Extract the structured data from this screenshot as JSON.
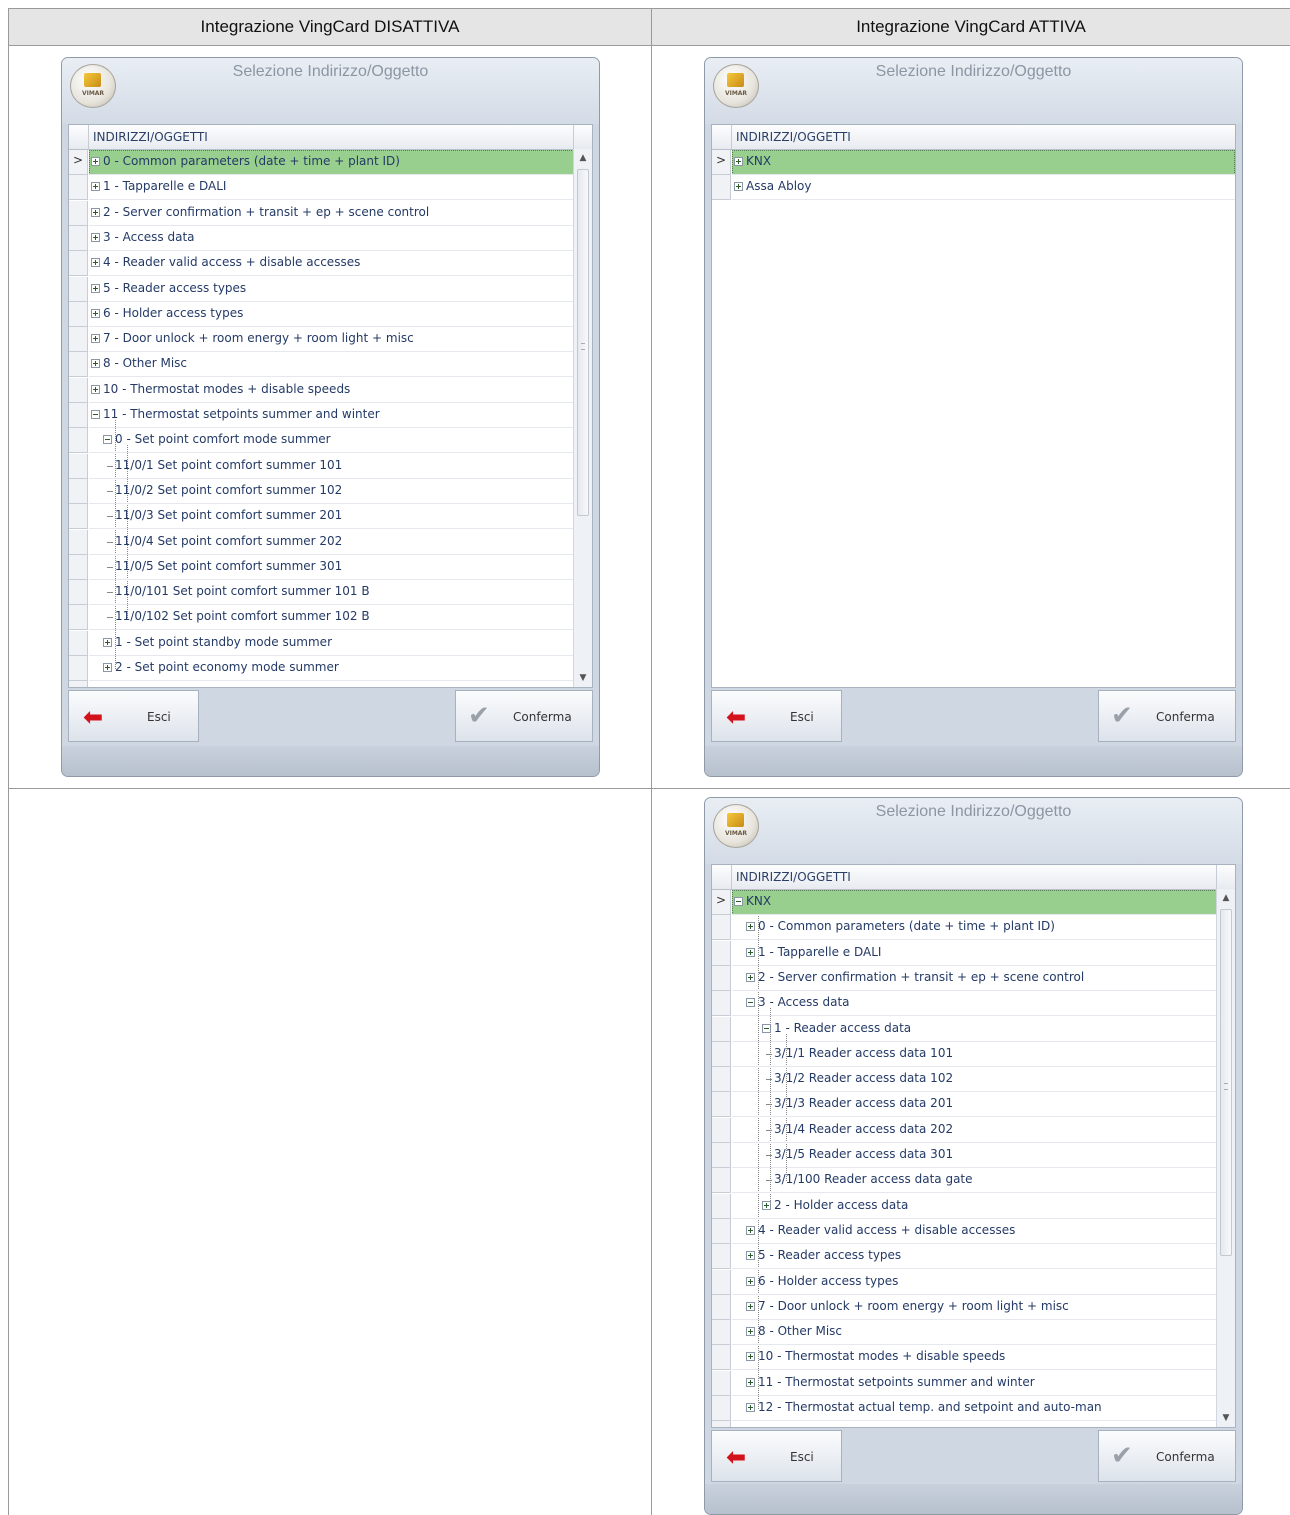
{
  "columns": {
    "left_header": "Integrazione VingCard DISATTIVA",
    "right_header": "Integrazione VingCard ATTIVA"
  },
  "windows": [
    {
      "title": "Selezione Indirizzo/Oggetto",
      "logo_text": "VIMAR",
      "grid_header": "INDIRIZZI/OGGETTI",
      "exit_label": "Esci",
      "confirm_label": "Conferma",
      "show_scrollbar": true,
      "rows": [
        {
          "label": "0 - Common parameters (date + time + plant ID)",
          "level": 0,
          "expander": "plus",
          "selected": true
        },
        {
          "label": "1 - Tapparelle e DALI",
          "level": 0,
          "expander": "plus"
        },
        {
          "label": "2 - Server confirmation + transit + ep + scene control",
          "level": 0,
          "expander": "plus"
        },
        {
          "label": "3 - Access data",
          "level": 0,
          "expander": "plus"
        },
        {
          "label": "4 - Reader valid access + disable accesses",
          "level": 0,
          "expander": "plus"
        },
        {
          "label": "5 - Reader access types",
          "level": 0,
          "expander": "plus"
        },
        {
          "label": "6 - Holder access types",
          "level": 0,
          "expander": "plus"
        },
        {
          "label": "7 - Door unlock + room energy + room light + misc",
          "level": 0,
          "expander": "plus"
        },
        {
          "label": "8 - Other Misc",
          "level": 0,
          "expander": "plus"
        },
        {
          "label": "10 - Thermostat modes + disable speeds",
          "level": 0,
          "expander": "plus"
        },
        {
          "label": "11 - Thermostat setpoints summer and winter",
          "level": 0,
          "expander": "minus"
        },
        {
          "label": "0 - Set point comfort mode summer",
          "level": 1,
          "expander": "minus"
        },
        {
          "label": "11/0/1 Set point comfort summer 101",
          "level": 2,
          "expander": "none"
        },
        {
          "label": "11/0/2 Set point comfort summer 102",
          "level": 2,
          "expander": "none"
        },
        {
          "label": "11/0/3 Set point comfort summer 201",
          "level": 2,
          "expander": "none"
        },
        {
          "label": "11/0/4 Set point comfort summer 202",
          "level": 2,
          "expander": "none"
        },
        {
          "label": "11/0/5 Set point comfort summer 301",
          "level": 2,
          "expander": "none"
        },
        {
          "label": "11/0/101 Set point comfort summer 101 B",
          "level": 2,
          "expander": "none"
        },
        {
          "label": "11/0/102 Set point comfort summer 102 B",
          "level": 2,
          "expander": "none"
        },
        {
          "label": "1 - Set point standby mode summer",
          "level": 1,
          "expander": "plus"
        },
        {
          "label": "2 - Set point economy mode summer",
          "level": 1,
          "expander": "plus"
        }
      ]
    },
    {
      "title": "Selezione Indirizzo/Oggetto",
      "logo_text": "VIMAR",
      "grid_header": "INDIRIZZI/OGGETTI",
      "exit_label": "Esci",
      "confirm_label": "Conferma",
      "show_scrollbar": false,
      "rows": [
        {
          "label": "KNX",
          "level": 0,
          "expander": "plus",
          "selected": true
        },
        {
          "label": "Assa Abloy",
          "level": 0,
          "expander": "plus"
        }
      ]
    },
    {
      "title": "Selezione Indirizzo/Oggetto",
      "logo_text": "VIMAR",
      "grid_header": "INDIRIZZI/OGGETTI",
      "exit_label": "Esci",
      "confirm_label": "Conferma",
      "show_scrollbar": true,
      "rows": [
        {
          "label": "KNX",
          "level": 0,
          "expander": "minus",
          "selected": true
        },
        {
          "label": "0 - Common parameters (date + time + plant ID)",
          "level": 1,
          "expander": "plus"
        },
        {
          "label": "1 - Tapparelle e DALI",
          "level": 1,
          "expander": "plus"
        },
        {
          "label": "2 - Server confirmation + transit + ep + scene control",
          "level": 1,
          "expander": "plus"
        },
        {
          "label": "3 - Access data",
          "level": 1,
          "expander": "minus"
        },
        {
          "label": "1 - Reader access data",
          "level": 2,
          "expander": "minus"
        },
        {
          "label": "3/1/1 Reader access data 101",
          "level": 3,
          "expander": "none"
        },
        {
          "label": "3/1/2 Reader access data 102",
          "level": 3,
          "expander": "none"
        },
        {
          "label": "3/1/3 Reader access data 201",
          "level": 3,
          "expander": "none"
        },
        {
          "label": "3/1/4 Reader access data 202",
          "level": 3,
          "expander": "none"
        },
        {
          "label": "3/1/5 Reader access data 301",
          "level": 3,
          "expander": "none"
        },
        {
          "label": "3/1/100 Reader access data gate",
          "level": 3,
          "expander": "none"
        },
        {
          "label": "2 - Holder access data",
          "level": 2,
          "expander": "plus"
        },
        {
          "label": "4 - Reader valid access + disable accesses",
          "level": 1,
          "expander": "plus"
        },
        {
          "label": "5 - Reader access types",
          "level": 1,
          "expander": "plus"
        },
        {
          "label": "6 - Holder access types",
          "level": 1,
          "expander": "plus"
        },
        {
          "label": "7 - Door unlock + room energy + room light + misc",
          "level": 1,
          "expander": "plus"
        },
        {
          "label": "8 - Other Misc",
          "level": 1,
          "expander": "plus"
        },
        {
          "label": "10 - Thermostat modes + disable speeds",
          "level": 1,
          "expander": "plus"
        },
        {
          "label": "11 - Thermostat setpoints summer and winter",
          "level": 1,
          "expander": "plus"
        },
        {
          "label": "12 - Thermostat actual temp. and setpoint and auto-man",
          "level": 1,
          "expander": "plus"
        }
      ]
    }
  ]
}
